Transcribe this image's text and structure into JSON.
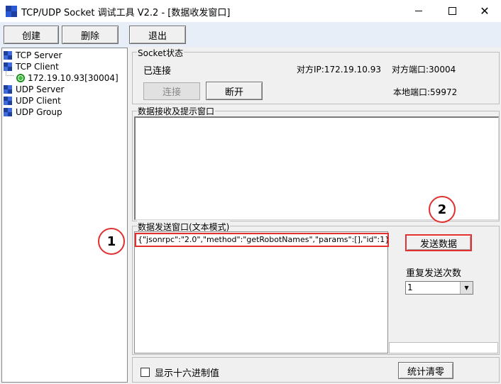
{
  "window": {
    "title": "TCP/UDP Socket 调试工具 V2.2 - [数据收发窗口]",
    "controls": {
      "minimize": "—",
      "maximize": "☐",
      "close": "✕"
    }
  },
  "toolbar": {
    "create_label": "创建",
    "delete_label": "删除",
    "exit_label": "退出"
  },
  "tree": {
    "items": [
      {
        "label": "TCP Server",
        "icon": "network-icon"
      },
      {
        "label": "TCP Client",
        "icon": "network-icon"
      },
      {
        "label": "172.19.10.93[30004]",
        "icon": "connection-icon"
      },
      {
        "label": "UDP Server",
        "icon": "network-icon"
      },
      {
        "label": "UDP Client",
        "icon": "network-icon"
      },
      {
        "label": "UDP Group",
        "icon": "network-icon"
      }
    ]
  },
  "socket_status": {
    "group_label": "Socket状态",
    "state": "已连接",
    "remote_ip": "对方IP:172.19.10.93",
    "remote_port": "对方端口:30004",
    "local_port": "本地端口:59972",
    "connect_label": "连接",
    "disconnect_label": "断开"
  },
  "receive": {
    "group_label": "数据接收及提示窗口"
  },
  "send": {
    "group_label": "数据发送窗口(文本模式)",
    "text": "{\"jsonrpc\":\"2.0\",\"method\":\"getRobotNames\",\"params\":[],\"id\":1}",
    "send_label": "发送数据",
    "repeat_label": "重复发送次数",
    "repeat_value": "1"
  },
  "footer": {
    "hex_label": "显示十六进制值",
    "clear_stats_label": "统计清零"
  },
  "annotations": {
    "badge1": "1",
    "badge2": "2"
  },
  "colors": {
    "highlight": "#e03030",
    "toolbar_bg": "#e8eef8"
  }
}
